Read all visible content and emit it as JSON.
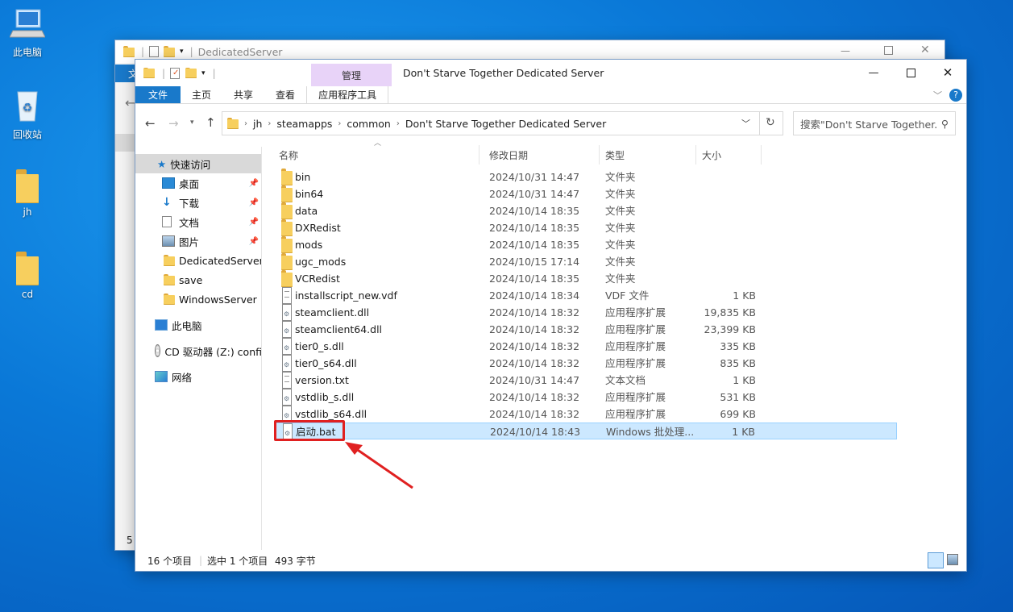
{
  "desktop": {
    "icons": [
      {
        "label": "此电脑"
      },
      {
        "label": "回收站"
      },
      {
        "label": "jh"
      },
      {
        "label": "cd"
      }
    ]
  },
  "back_window": {
    "title": "DedicatedServer",
    "file_tab": "文",
    "edge_digit": "5"
  },
  "window": {
    "title": "Don't Starve Together Dedicated Server",
    "manage_label": "管理",
    "tabs": [
      "文件",
      "主页",
      "共享",
      "查看",
      "应用程序工具"
    ],
    "breadcrumb": [
      "jh",
      "steamapps",
      "common",
      "Don't Starve Together Dedicated Server"
    ],
    "search_placeholder": "搜索\"Don't Starve Together...",
    "sidebar": [
      {
        "label": "快速访问"
      },
      {
        "label": "桌面"
      },
      {
        "label": "下载"
      },
      {
        "label": "文档"
      },
      {
        "label": "图片"
      },
      {
        "label": "DedicatedServer"
      },
      {
        "label": "save"
      },
      {
        "label": "WindowsServer"
      },
      {
        "label": "此电脑"
      },
      {
        "label": "CD 驱动器 (Z:) confi"
      },
      {
        "label": "网络"
      }
    ],
    "columns": {
      "name": "名称",
      "date": "修改日期",
      "type": "类型",
      "size": "大小"
    },
    "files": [
      {
        "name": "bin",
        "date": "2024/10/31 14:47",
        "type": "文件夹",
        "size": ""
      },
      {
        "name": "bin64",
        "date": "2024/10/31 14:47",
        "type": "文件夹",
        "size": ""
      },
      {
        "name": "data",
        "date": "2024/10/14 18:35",
        "type": "文件夹",
        "size": ""
      },
      {
        "name": "DXRedist",
        "date": "2024/10/14 18:35",
        "type": "文件夹",
        "size": ""
      },
      {
        "name": "mods",
        "date": "2024/10/14 18:35",
        "type": "文件夹",
        "size": ""
      },
      {
        "name": "ugc_mods",
        "date": "2024/10/15 17:14",
        "type": "文件夹",
        "size": ""
      },
      {
        "name": "VCRedist",
        "date": "2024/10/14 18:35",
        "type": "文件夹",
        "size": ""
      },
      {
        "name": "installscript_new.vdf",
        "date": "2024/10/14 18:34",
        "type": "VDF 文件",
        "size": "1 KB"
      },
      {
        "name": "steamclient.dll",
        "date": "2024/10/14 18:32",
        "type": "应用程序扩展",
        "size": "19,835 KB"
      },
      {
        "name": "steamclient64.dll",
        "date": "2024/10/14 18:32",
        "type": "应用程序扩展",
        "size": "23,399 KB"
      },
      {
        "name": "tier0_s.dll",
        "date": "2024/10/14 18:32",
        "type": "应用程序扩展",
        "size": "335 KB"
      },
      {
        "name": "tier0_s64.dll",
        "date": "2024/10/14 18:32",
        "type": "应用程序扩展",
        "size": "835 KB"
      },
      {
        "name": "version.txt",
        "date": "2024/10/31 14:47",
        "type": "文本文档",
        "size": "1 KB"
      },
      {
        "name": "vstdlib_s.dll",
        "date": "2024/10/14 18:32",
        "type": "应用程序扩展",
        "size": "531 KB"
      },
      {
        "name": "vstdlib_s64.dll",
        "date": "2024/10/14 18:32",
        "type": "应用程序扩展",
        "size": "699 KB"
      },
      {
        "name": "启动.bat",
        "date": "2024/10/14 18:43",
        "type": "Windows 批处理...",
        "size": "1 KB"
      }
    ],
    "status": {
      "count": "16 个项目",
      "selected": "选中 1 个项目",
      "size": "493 字节"
    }
  },
  "colors": {
    "accent": "#1979ca",
    "selection": "#cce8ff",
    "highlight": "#e02020",
    "folder": "#f7cf5e"
  }
}
